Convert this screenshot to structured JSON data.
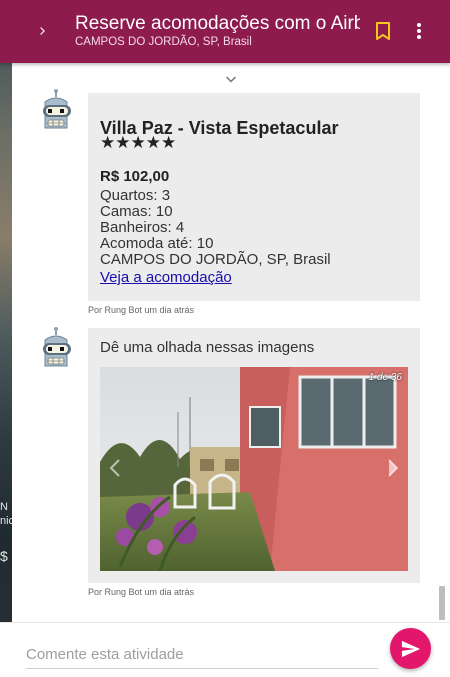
{
  "header": {
    "title": "Reserve acomodações com o Airbnb",
    "subtitle": "CAMPOS DO JORDÃO, SP, Brasil",
    "expand_icon": "chevron-right-icon",
    "bookmark_icon": "bookmark-icon",
    "menu_icon": "more-vertical-icon",
    "color": "#8e1b4e",
    "accent": "#f5c518"
  },
  "background": {
    "peek_text": "N\nnic",
    "peek_price": "$"
  },
  "listing": {
    "title": "Villa Paz - Vista Espetacular",
    "stars": "★★★★★",
    "rating": 5,
    "price": "R$ 102,00",
    "rooms": "Quartos: 3",
    "beds": "Camas: 10",
    "baths": "Banheiros: 4",
    "guests": "Acomoda até: 10",
    "location": "CAMPOS DO JORDÃO, SP, Brasil",
    "link": "Veja a acomodação",
    "meta": "Por Rung Bot um dia atrás"
  },
  "images_post": {
    "text": "Dê uma olhada nessas imagens",
    "counter": "1 de 36",
    "meta": "Por Rung Bot um dia atrás"
  },
  "comment": {
    "placeholder": "Comente esta atividade",
    "send_icon": "send-icon",
    "send_color": "#e2166b"
  }
}
